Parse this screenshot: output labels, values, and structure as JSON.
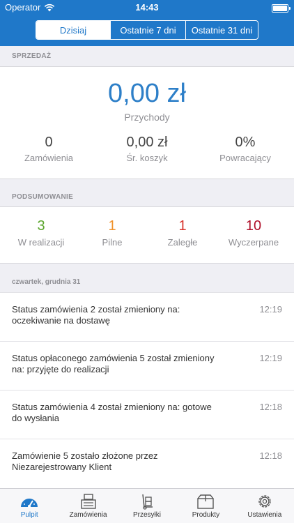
{
  "status_bar": {
    "carrier": "Operator",
    "time": "14:43"
  },
  "period_tabs": [
    {
      "label": "Dzisiaj",
      "active": true
    },
    {
      "label": "Ostatnie 7 dni",
      "active": false
    },
    {
      "label": "Ostatnie 31 dni",
      "active": false
    }
  ],
  "sales": {
    "heading": "SPRZEDAŻ",
    "revenue_value": "0,00 zł",
    "revenue_label": "Przychody",
    "stats": [
      {
        "value": "0",
        "label": "Zamówienia"
      },
      {
        "value": "0,00 zł",
        "label": "Śr. koszyk"
      },
      {
        "value": "0%",
        "label": "Powracający"
      }
    ]
  },
  "summary": {
    "heading": "PODSUMOWANIE",
    "items": [
      {
        "value": "3",
        "label": "W realizacji",
        "color": "#5aa52c"
      },
      {
        "value": "1",
        "label": "Pilne",
        "color": "#f0922b"
      },
      {
        "value": "1",
        "label": "Zaległe",
        "color": "#d8332c"
      },
      {
        "value": "10",
        "label": "Wyczerpane",
        "color": "#b0102a"
      }
    ]
  },
  "feed": {
    "date_heading": "czwartek, grudnia 31",
    "items": [
      {
        "text": "Status zamówienia 2 został zmieniony na: oczekiwanie na dostawę",
        "time": "12:19"
      },
      {
        "text": "Status opłaconego zamówienia 5 został zmieniony na: przyjęte do realizacji",
        "time": "12:19"
      },
      {
        "text": "Status zamówienia 4 został zmieniony na: gotowe do wysłania",
        "time": "12:18"
      },
      {
        "text": "Zamówienie 5 zostało złożone przez Niezarejestrowany Klient",
        "time": "12:18"
      }
    ]
  },
  "tabbar": [
    {
      "label": "Pulpit",
      "icon": "speedometer-icon",
      "active": true
    },
    {
      "label": "Zamówienia",
      "icon": "cash-register-icon",
      "active": false
    },
    {
      "label": "Przesyłki",
      "icon": "hand-truck-icon",
      "active": false
    },
    {
      "label": "Produkty",
      "icon": "box-icon",
      "active": false
    },
    {
      "label": "Ustawienia",
      "icon": "gear-icon",
      "active": false
    }
  ],
  "colors": {
    "brand": "#1f78c9",
    "revenue": "#2d7fc8"
  }
}
